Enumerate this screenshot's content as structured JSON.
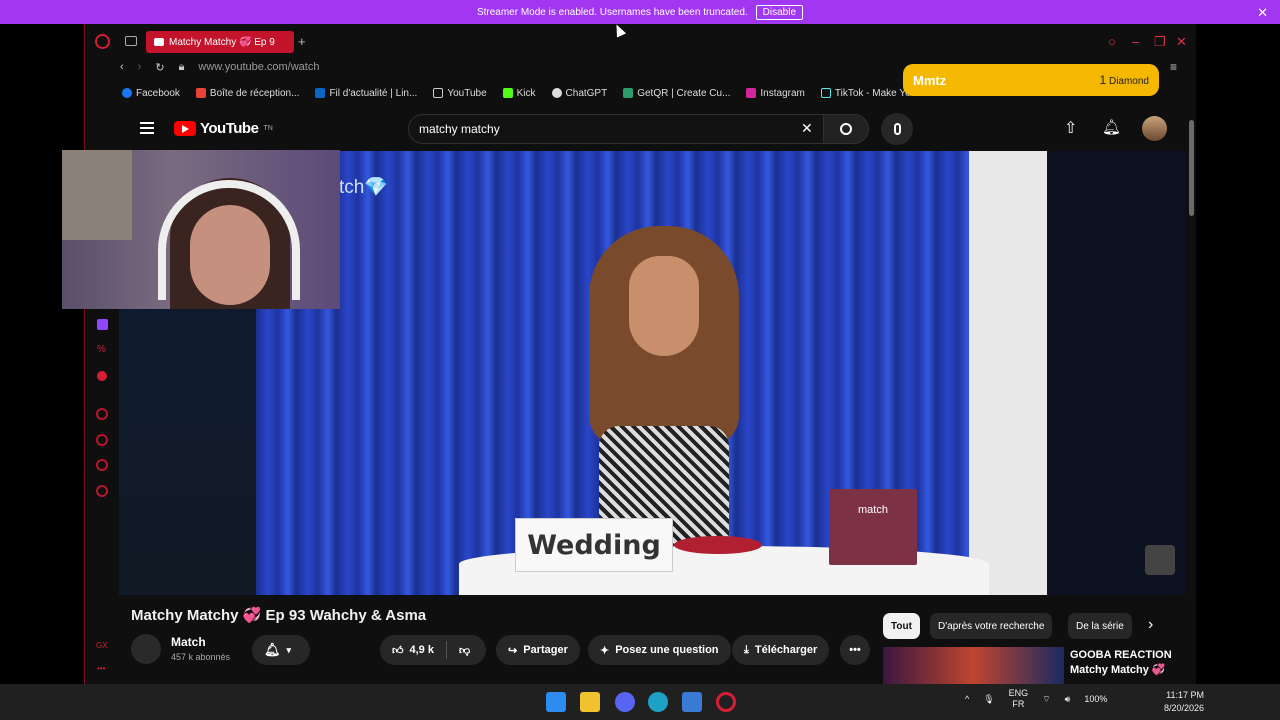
{
  "banner": {
    "text": "Streamer Mode is enabled. Usernames have been truncated.",
    "button": "Disable",
    "close": "✕"
  },
  "browser": {
    "tab_title": "Matchy Matchy 💞 Ep 9",
    "new_tab": "+",
    "address": "www.youtube.com/watch",
    "bookmarks": [
      "Facebook",
      "Boîte de réception...",
      "Fil d'actualité | Lin...",
      "YouTube",
      "Kick",
      "ChatGPT",
      "GetQR | Create Cu...",
      "Instagram",
      "TikTok - Make You..."
    ]
  },
  "youtube": {
    "logo_text": "YouTube",
    "logo_sup": "TN",
    "search_value": "matchy matchy",
    "clear": "✕"
  },
  "video": {
    "name_card": "Wedding",
    "box_label": "match",
    "watermark": "tch💎"
  },
  "alert": {
    "username": "Mmtz",
    "amount": "1",
    "currency": "Diamond"
  },
  "details": {
    "title": "Matchy Matchy 💞 Ep 93 Wahchy & Asma",
    "channel": "Match",
    "subscribers": "457 k abonnés",
    "likes": "4,9 k",
    "share": "Partager",
    "ask": "Posez une question",
    "download": "Télécharger",
    "more": "•••"
  },
  "chips": [
    "Tout",
    "D'après votre recherche",
    "De la série"
  ],
  "chip_next": "›",
  "recommendation": {
    "title": "GOOBA REACTION Matchy Matchy 💞"
  },
  "taskbar": {
    "lang_top": "ENG",
    "lang_bottom": "FR",
    "battery": "100%",
    "time": "11:17 PM",
    "date": "8/20/2026",
    "chevron": "^"
  },
  "colors": {
    "banner": "#a237f2",
    "opera_red": "#d61e37",
    "alert": "#f5b800",
    "youtube_red": "#ff0000"
  }
}
